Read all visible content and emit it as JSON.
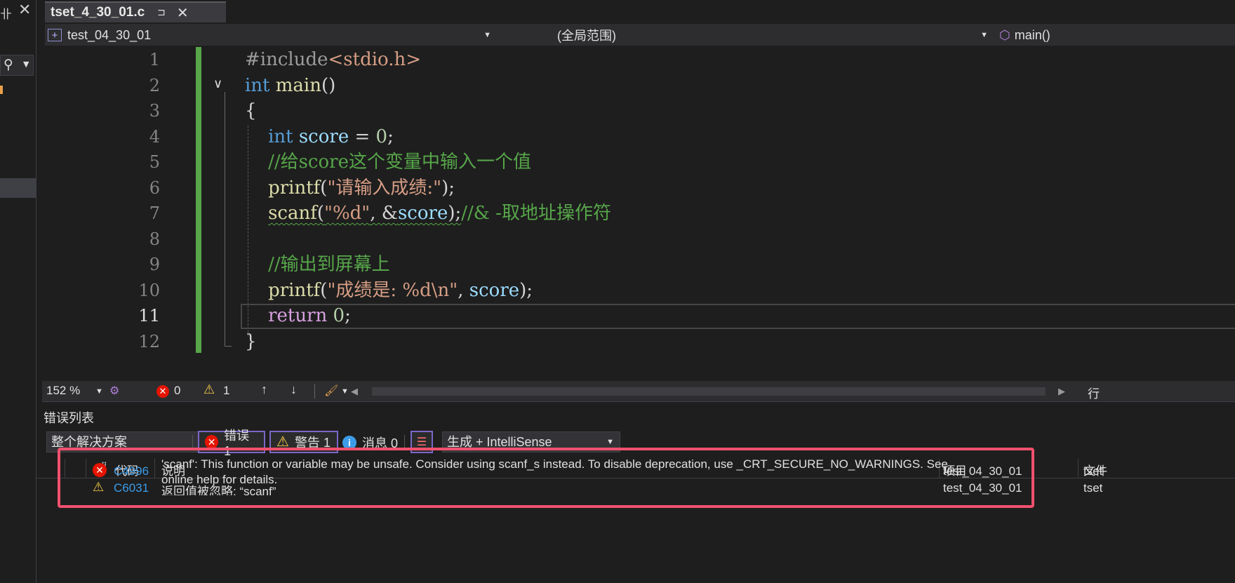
{
  "tab": {
    "filename": "tset_4_30_01.c",
    "pin": "⊐",
    "close": "✕"
  },
  "nav": {
    "project": "test_04_30_01",
    "scope": "(全局范围)",
    "function": "main()"
  },
  "editor": {
    "line_numbers": [
      "1",
      "2",
      "3",
      "4",
      "5",
      "6",
      "7",
      "8",
      "9",
      "10",
      "11",
      "12"
    ],
    "current_line": "11",
    "code": {
      "l1": {
        "pre": "#include",
        "hdr": "<stdio.h>"
      },
      "l2": {
        "kw": "int",
        "fn": " main",
        "p": "()"
      },
      "l3": "{",
      "l4": {
        "kw": "int",
        "var": " score",
        "p": " = ",
        "num": "0",
        "end": ";"
      },
      "l5": "//给score这个变量中输入一个值",
      "l6": {
        "fn": "printf",
        "p1": "(",
        "str": "\"请输入成绩:\"",
        "p2": ");"
      },
      "l7": {
        "fn": "scanf",
        "p1": "(",
        "str": "\"%d\"",
        "p2": ", &",
        "var": "score",
        "p3": ");",
        "cmt": "//& -取地址操作符"
      },
      "l9": "//输出到屏幕上",
      "l10": {
        "fn": "printf",
        "p1": "(",
        "str": "\"成绩是: %d\\n\"",
        "p2": ", ",
        "var": "score",
        "p3": ");"
      },
      "l11": {
        "kw": "return",
        "p": " ",
        "num": "0",
        "end": ";"
      },
      "l12": "}"
    }
  },
  "status": {
    "zoom": "152 %",
    "errors": "0",
    "warnings": "1",
    "row_col": "行"
  },
  "error_list": {
    "title": "错误列表",
    "scope": "整个解决方案",
    "errors_btn": "错误 1",
    "warnings_btn": "警告 1",
    "messages_btn": "消息 0",
    "build_filter": "生成 + IntelliSense",
    "columns": {
      "code": "代码",
      "desc": "说明",
      "project": "项目",
      "file": "文件"
    },
    "rows": [
      {
        "code": "C6031",
        "desc": "返回值被忽略: “scanf”",
        "project": "test_04_30_01",
        "file": "tset"
      },
      {
        "code": "C4996",
        "desc_l1": "'scanf': This function or variable may be unsafe. Consider using scanf_s instead. To disable deprecation, use _CRT_SECURE_NO_WARNINGS. See",
        "desc_l2": "online help for details.",
        "project": "test_04_30_01",
        "file": "tset"
      }
    ]
  }
}
